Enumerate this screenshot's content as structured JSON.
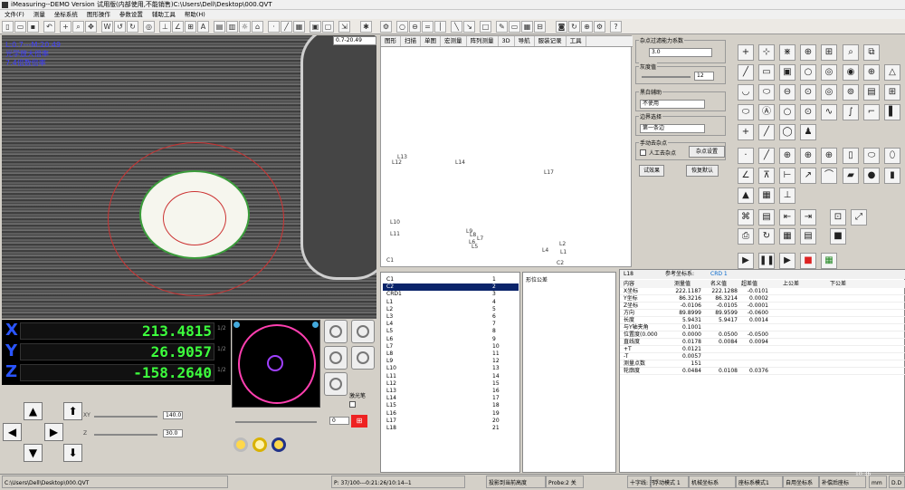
{
  "window": {
    "title": "iMeasuring--DEMO  Version  试用版(内部使用,不能销售)C:\\Users\\Dell\\Desktop\\000.QVT"
  },
  "menu": [
    "文件(F)",
    "测量",
    "坐标系统",
    "图形操作",
    "参数设置",
    "辅助工具",
    "帮助(H)"
  ],
  "camera": {
    "coord_text": "L:0.7---M:20.49",
    "overlay_line1": "光学放大倍率",
    "overlay_line2": "7.4倍数倍率",
    "lens_select": "0.7-20.49"
  },
  "dro": {
    "x_label": "X",
    "x_value": "213.4815",
    "y_label": "Y",
    "y_value": "26.9057",
    "z_label": "Z",
    "z_value": "-158.2640",
    "half": "1/2"
  },
  "motion": {
    "xy_label": "XY",
    "xy_value": "140.0",
    "z_label": "Z",
    "z_value": "30.0",
    "cam_value": "0",
    "laser_label": "激光笔"
  },
  "graphics": {
    "tabs": [
      "图形",
      "扫描",
      "单图",
      "宏测量",
      "阵列测量",
      "3D",
      "导航",
      "服装记录",
      "工具"
    ],
    "features": [
      "L12",
      "L13",
      "L14",
      "L17",
      "L10",
      "L11",
      "L9",
      "L8",
      "L7",
      "L6",
      "L5",
      "L4",
      "L2",
      "L1",
      "C2",
      "C1"
    ]
  },
  "props": {
    "noise_label": "杂点过滤能力系数",
    "noise_value": "3.0",
    "threshold_label": "灰度值",
    "threshold_value": "12",
    "bw_label": "黑白辅助",
    "bw_value": "不使用",
    "edge_label": "边界选择",
    "edge_value": "第一条边",
    "manual_label": "手动去杂点",
    "manual_check": "人工去杂点",
    "noise_btn": "杂点设置",
    "try_btn": "试效果",
    "restore_btn": "恢复默认"
  },
  "feature_list": [
    {
      "name": "C1",
      "n": "1"
    },
    {
      "name": "C2",
      "n": "2"
    },
    {
      "name": "CRD1",
      "n": "3"
    },
    {
      "name": "L1",
      "n": "4"
    },
    {
      "name": "L2",
      "n": "5"
    },
    {
      "name": "L3",
      "n": "6"
    },
    {
      "name": "L4",
      "n": "7"
    },
    {
      "name": "L5",
      "n": "8"
    },
    {
      "name": "L6",
      "n": "9"
    },
    {
      "name": "L7",
      "n": "10"
    },
    {
      "name": "L8",
      "n": "11"
    },
    {
      "name": "L9",
      "n": "12"
    },
    {
      "name": "L10",
      "n": "13"
    },
    {
      "name": "L11",
      "n": "14"
    },
    {
      "name": "L12",
      "n": "15"
    },
    {
      "name": "L13",
      "n": "16"
    },
    {
      "name": "L14",
      "n": "17"
    },
    {
      "name": "L15",
      "n": "18"
    },
    {
      "name": "L16",
      "n": "19"
    },
    {
      "name": "L17",
      "n": "20"
    },
    {
      "name": "L18",
      "n": "21"
    }
  ],
  "tree": {
    "item": "形位公差"
  },
  "results": {
    "feature": "L18",
    "ref_label": "参考坐标系:",
    "ref_value": "CRD 1",
    "headers": [
      "内容",
      "测量值",
      "名义值",
      "超差值",
      "上公差",
      "下公差"
    ],
    "rows": [
      [
        "X坐标",
        "222.1187",
        "222.1288",
        "-0.0101"
      ],
      [
        "Y坐标",
        "86.3216",
        "86.3214",
        "0.0002"
      ],
      [
        "Z坐标",
        "-0.0106",
        "-0.0105",
        "-0.0001"
      ],
      [
        "方向",
        "89.8999",
        "89.9599",
        "-0.0600"
      ],
      [
        "长度",
        "5.9431",
        "5.9417",
        "0.0014"
      ],
      [
        "与Y轴夹角",
        "0.1001",
        "",
        ""
      ],
      [
        "位置度(0.000",
        "0.0000",
        "0.0500",
        "-0.0500"
      ],
      [
        "直线度",
        "0.0178",
        "0.0084",
        "0.0094"
      ],
      [
        "+T",
        "0.0121",
        "",
        ""
      ],
      [
        "-T",
        "0.0057",
        "",
        ""
      ],
      [
        "测量点数",
        "151",
        "",
        ""
      ],
      [
        "轮廓度",
        "0.0484",
        "0.0108",
        "0.0376"
      ]
    ]
  },
  "status": {
    "path": "C:\\Users\\Dell\\Desktop\\000.QVT",
    "pos": "P: 37/100---0:21:26/10:14--1",
    "proj": "投影到当前高度",
    "probe": "Probe:2 关",
    "cross": "十字线: 开",
    "move": "浮动模式 1",
    "machine": "机械坐标系",
    "coord": "座标系模式1",
    "auto": "自用坐标系",
    "comp": "补偿后座标",
    "unit1": "mm",
    "unit2": "D.D",
    "time": "10:36"
  }
}
